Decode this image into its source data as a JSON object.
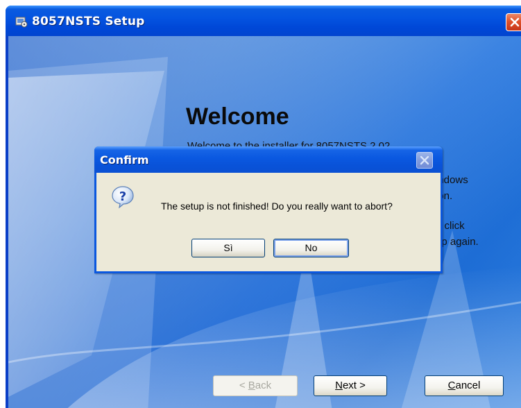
{
  "main_window": {
    "title": "8057NSTS Setup",
    "welcome": {
      "heading": "Welcome",
      "line1": "Welcome to the installer for 8057NSTS 2.02",
      "line2": "indows",
      "line3": "ion.",
      "line4": "e click",
      "line5": "up again."
    },
    "buttons": {
      "back": {
        "label": "Back",
        "prefix": "< ",
        "accel": "B",
        "rest": "ack",
        "enabled": false
      },
      "next": {
        "label": "Next >",
        "accel": "N",
        "rest": "ext >"
      },
      "cancel": {
        "label": "Cancel",
        "accel": "C",
        "rest": "ancel"
      }
    }
  },
  "confirm_dialog": {
    "title": "Confirm",
    "message": "The setup is not finished! Do you really want to abort?",
    "icon": "question-icon",
    "buttons": {
      "yes": "Sì",
      "no": "No"
    }
  },
  "colors": {
    "titlebar_blue": "#0454e0",
    "dialog_face": "#ece9d8",
    "close_red": "#e0522b"
  }
}
